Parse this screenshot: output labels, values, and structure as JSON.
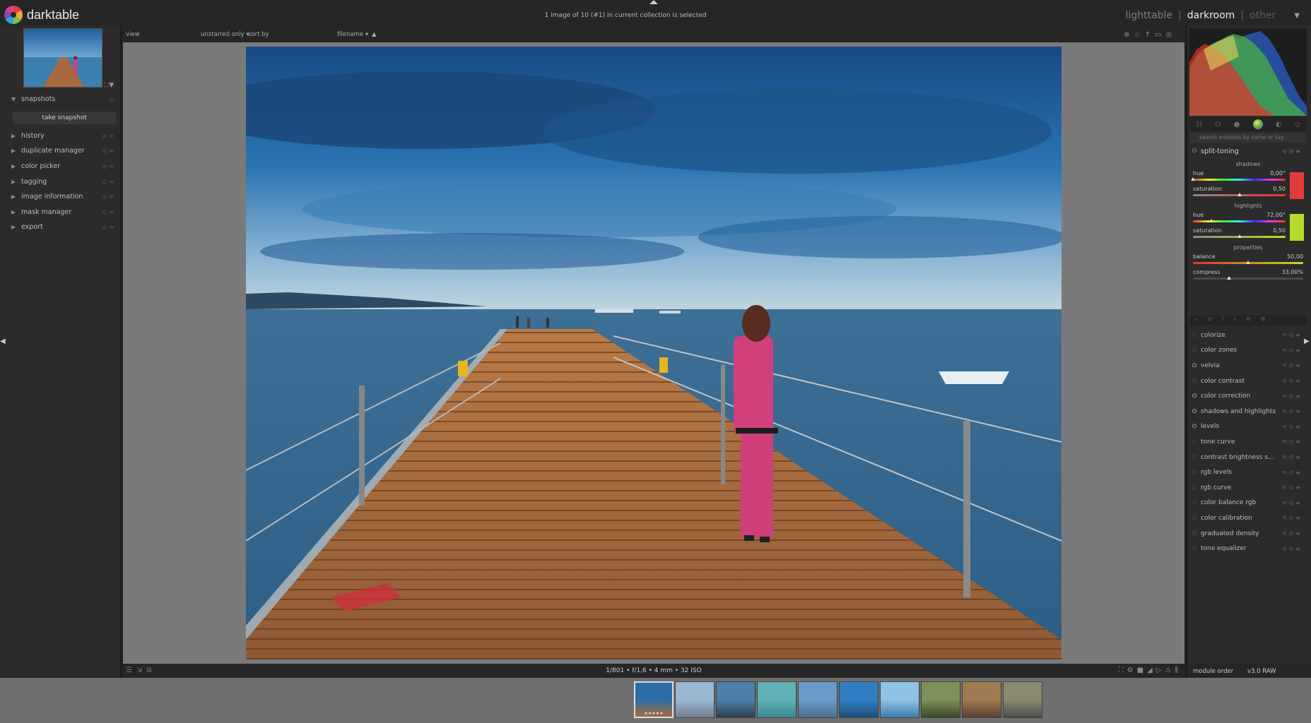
{
  "app": {
    "name": "darktable"
  },
  "top": {
    "status": "1 image of 10 (#1) in current collection is selected",
    "views": {
      "lighttable": "lighttable",
      "darkroom": "darkroom",
      "other": "other",
      "sep": "|"
    }
  },
  "left_panel": {
    "snapshots": {
      "label": "snapshots",
      "take_snapshot": "take snapshot"
    },
    "modules": [
      "history",
      "duplicate manager",
      "color picker",
      "tagging",
      "image information",
      "mask manager",
      "export"
    ]
  },
  "toolbar": {
    "view": "view",
    "rating_filter": "unstarred only",
    "sort_by_label": "sort by",
    "sort_field": "filename",
    "sort_direction": "▲"
  },
  "statusbar": {
    "exif": "1/801 • f/1,6 • 4 mm • 32 ISO"
  },
  "right_panel": {
    "search_placeholder": "search modules by name or tag",
    "split_toning": {
      "title": "split-toning",
      "shadows": {
        "label": "shadows",
        "hue_label": "hue",
        "hue": "0,00°",
        "saturation_label": "saturation",
        "saturation": "0,50",
        "color": "#e23a3a",
        "hue_fraction": 0.0,
        "saturation_fraction": 0.5
      },
      "highlights": {
        "label": "highlights",
        "hue_label": "hue",
        "hue": "72,00°",
        "saturation_label": "saturation",
        "saturation": "0,50",
        "color": "#b7db2c",
        "hue_fraction": 0.2,
        "saturation_fraction": 0.5
      },
      "properties": {
        "label": "properties",
        "balance_label": "balance",
        "balance": "50,00",
        "compress_label": "compress",
        "compress": "33,00%",
        "balance_fraction": 0.5,
        "compress_fraction": 0.33
      }
    },
    "modules": [
      {
        "name": "colorize",
        "on": false
      },
      {
        "name": "color zones",
        "on": false
      },
      {
        "name": "velvia",
        "on": true
      },
      {
        "name": "color contrast",
        "on": false
      },
      {
        "name": "color correction",
        "on": true
      },
      {
        "name": "shadows and highlights",
        "on": true
      },
      {
        "name": "levels",
        "on": true
      },
      {
        "name": "tone curve",
        "on": false
      },
      {
        "name": "contrast brightness s...",
        "on": false
      },
      {
        "name": "rgb levels",
        "on": false
      },
      {
        "name": "rgb curve",
        "on": false
      },
      {
        "name": "color balance rgb",
        "on": false
      },
      {
        "name": "color calibration",
        "on": false
      },
      {
        "name": "graduated density",
        "on": false
      },
      {
        "name": "tone equalizer",
        "on": false
      }
    ],
    "footer": {
      "module_order_label": "module order",
      "module_order": "v3.0 RAW"
    }
  },
  "filmstrip": {
    "count": 10,
    "selected_index": 0,
    "selected_stars": "★★★★★"
  }
}
